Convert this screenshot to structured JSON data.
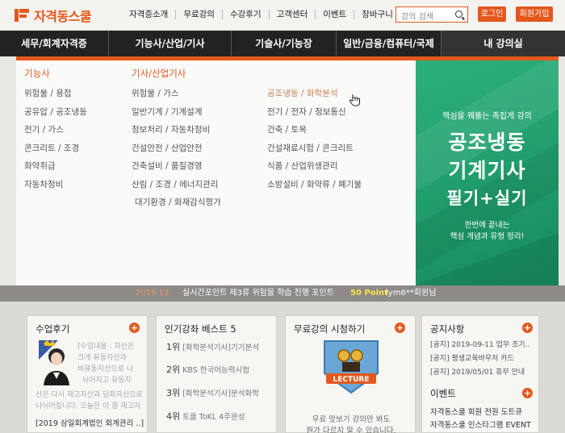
{
  "header": {
    "logo_text": "자격동스쿨",
    "nav": [
      "자격증소개",
      "무료강의",
      "수강후기",
      "고객센터",
      "이벤트",
      "장바구니"
    ],
    "search_placeholder": "강의 검색",
    "login_label": "로그인",
    "join_label": "회원가입"
  },
  "mainnav": {
    "items": [
      "세무/회계자격증",
      "기능사/산업/기사",
      "기술사/기능장",
      "일반/금융/컴퓨터/국제",
      "내 강의실"
    ]
  },
  "mega": {
    "col1_title": "기능사",
    "col1": [
      "위험물 / 용접",
      "공유압 / 공조냉동",
      "전기 / 가스",
      "콘크리트 / 조경",
      "화약취급",
      "자동차정비"
    ],
    "col2_title": "기사/산업기사",
    "col2": [
      "위험물 / 가스",
      "일반기계 / 기계설계",
      "정보처리 / 자동차정비",
      "건설안전 / 산업안전",
      "건축설비 / 품질경영",
      "산림 / 조경 / 에너지관리",
      "대기환경 / 화재감식평가"
    ],
    "col3": [
      "공조냉동 / 화학분석",
      "전기 / 전자 / 정보통신",
      "건축 / 토목",
      "건설재료시험 / 콘크리트",
      "식품 / 산업위생관리",
      "소방설비 / 화약류 / 폐기물"
    ]
  },
  "banner": {
    "sub": "핵심을 꿰뚫는 족집게 강의",
    "line1": "공조냉동",
    "line2": "기계기사",
    "line3": "필기+실기",
    "small1": "한번에 끝내는",
    "small2": "핵심 개념과 유형 정리!"
  },
  "ticker": {
    "prefix": "2019.12.",
    "main": "실시간포인트 제3류 위험물 학습 진행 포인트",
    "points": "50 Point",
    "user": "lym6**회원님"
  },
  "cards": {
    "review": {
      "title": "수업후기",
      "text": [
        "[수업내용 : 자산은",
        "크게 유동자산과",
        "비유동자산으로 나",
        "뉘어지고 유동자",
        "산은 다시 재고자산과 당좌자산으로",
        "나뉘어집니다. 오늘은 이 중 재고자"
      ],
      "bottom": "[2019 삼일회계법인 회계관리 ..]"
    },
    "best": {
      "title": "인기강좌 베스트 5",
      "items": [
        {
          "num": "1위",
          "label": "[화학분석기사]기기분석"
        },
        {
          "num": "2위",
          "label": "KBS 한국어능력시험"
        },
        {
          "num": "3위",
          "label": "[화학분석기사]분석화학"
        },
        {
          "num": "4위",
          "label": "토클 ToKL 4주완성"
        }
      ]
    },
    "free": {
      "title": "무료강의 시청하기",
      "badge": "LECTURE",
      "text1": "무료 맛보기 강의만 봐도",
      "text2": "뭔가 다르지 알 수 있습니다."
    },
    "notice": {
      "title": "공지사항",
      "items": [
        "[공지] 2019-09-11 업무 조기..",
        "[공지] 평생교육바우처 카드",
        "[공지] 2019/05/01 휴무 안내"
      ],
      "event_title": "이벤트",
      "events": [
        "자격동스쿨 회원 전원 도트큐",
        "자격동스쿨 인스타그램 EVENT"
      ]
    }
  },
  "colors": {
    "accent": "#e3581d",
    "nav_bg": "#222222",
    "banner": "#1f9a6a"
  }
}
